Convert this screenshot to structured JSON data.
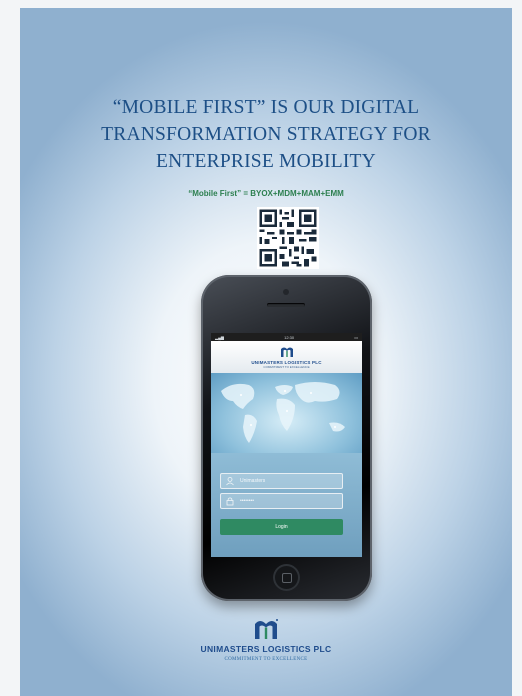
{
  "headline": "“MOBILE FIRST” IS OUR DIGITAL\nTRANSFORMATION STRATEGY FOR\nENTERPRISE MOBILITY",
  "subheadline": "“Mobile First” = BYOX+MDM+MAM+EMM",
  "phone": {
    "status_time": "12:30",
    "app_logo_text": "UNIMASTERS LOGISTICS PLC",
    "app_tagline": "COMMITMENT TO EXCELLENCE",
    "username_value": "Unimasters",
    "password_value": "••••••••",
    "login_label": "Login"
  },
  "brand": {
    "name": "UNIMASTERS LOGISTICS PLC",
    "tagline": "COMMITMENT TO EXCELLENCE"
  },
  "colors": {
    "headline": "#1d4f86",
    "subheadline": "#2c7f4f",
    "login_button": "#2f8a62",
    "brand": "#1f4c8c"
  }
}
